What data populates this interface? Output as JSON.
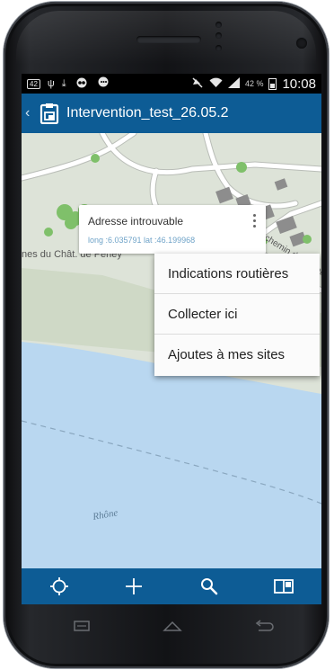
{
  "status_bar": {
    "left_icons": [
      "notification-badge-icon",
      "usb-icon",
      "download-icon",
      "voicemail-icon",
      "chat-icon"
    ],
    "notification_count": "42",
    "right_icons": [
      "mute-icon",
      "wifi-icon",
      "signal-icon",
      "battery-icon"
    ],
    "battery_percent": "42 %",
    "clock": "10:08"
  },
  "app_bar": {
    "back_icon": "chevron-left-icon",
    "app_icon": "clipboard-icon",
    "title": "Intervention_test_26.05.2"
  },
  "map": {
    "place_label": "nes du Chât. de Peney",
    "road_label": "chemin du sculpte",
    "river_label": "Rhône",
    "colors": {
      "land": "#dde3d8",
      "water": "#b9d7f0",
      "road": "#ffffff",
      "building": "#8d8d8d",
      "vegetation": "#7fc06a"
    }
  },
  "callout": {
    "title": "Adresse introuvable",
    "coordinates": "long :6.035791 lat :46.199968",
    "more_icon": "more-vertical-icon"
  },
  "context_menu": {
    "items": [
      {
        "label": "Indications routières"
      },
      {
        "label": "Collecter ici"
      },
      {
        "label": "Ajoutes à mes sites"
      }
    ]
  },
  "toolbar": {
    "buttons": [
      {
        "icon": "locate-icon"
      },
      {
        "icon": "add-icon"
      },
      {
        "icon": "search-icon"
      },
      {
        "icon": "map-book-icon"
      }
    ],
    "color": "#0d5c95"
  },
  "nav_keys": [
    "recent-apps-icon",
    "home-icon",
    "back-icon"
  ]
}
